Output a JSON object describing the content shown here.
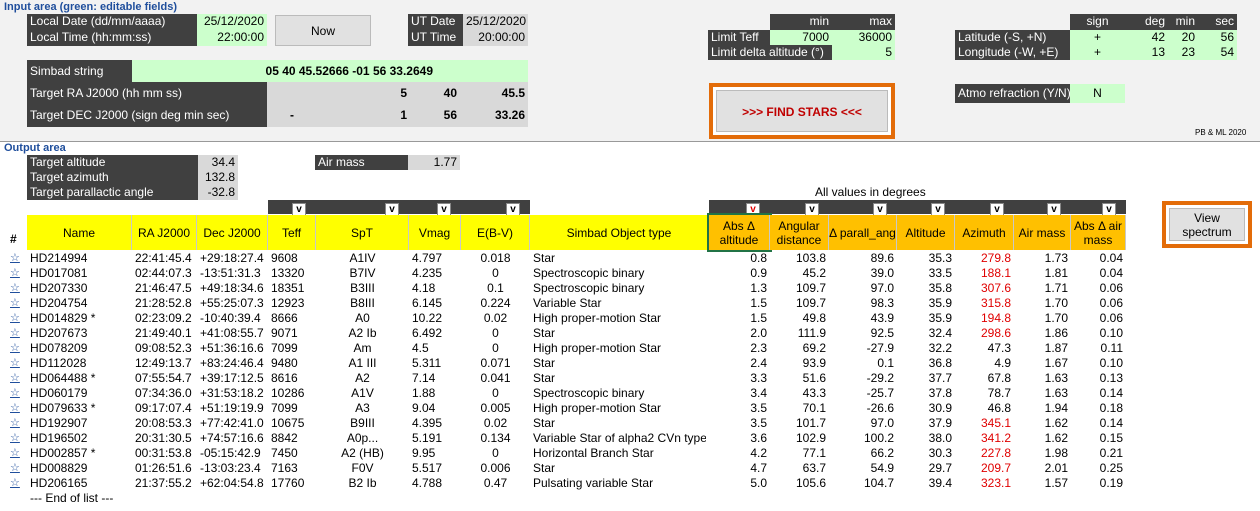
{
  "input": {
    "section_title": "Input area (green: editable fields)",
    "local_date_label": "Local Date (dd/mm/aaaa)",
    "local_date": "25/12/2020",
    "local_time_label": "Local Time (hh:mm:ss)",
    "local_time": "22:00:00",
    "now_button": "Now",
    "ut_date_label": "UT Date",
    "ut_date": "25/12/2020",
    "ut_time_label": "UT Time",
    "ut_time": "20:00:00",
    "simbad_label": "Simbad string",
    "simbad_value": "05 40 45.52666 -01 56 33.2649",
    "ra_label": "Target RA J2000 (hh mm ss)",
    "ra_sign": "",
    "ra_h": "5",
    "ra_m": "40",
    "ra_s": "45.5",
    "dec_label": "Target DEC J2000 (sign deg min sec)",
    "dec_sign": "-",
    "dec_d": "1",
    "dec_m": "56",
    "dec_s": "33.26",
    "limits_min_hdr": "min",
    "limits_max_hdr": "max",
    "teff_label": "Limit Teff",
    "teff_min": "7000",
    "teff_max": "36000",
    "dalt_label": "Limit delta altitude (°)",
    "dalt_max": "5",
    "find_button": ">>> FIND STARS <<<",
    "geo_sign_hdr": "sign",
    "geo_deg_hdr": "deg",
    "geo_min_hdr": "min",
    "geo_sec_hdr": "sec",
    "lat_label": "Latitude (-S, +N)",
    "lat_sign": "+",
    "lat_deg": "42",
    "lat_min": "20",
    "lat_sec": "56",
    "lon_label": "Longitude (-W, +E)",
    "lon_sign": "+",
    "lon_deg": "13",
    "lon_min": "23",
    "lon_sec": "54",
    "atmo_label": "Atmo refraction (Y/N)",
    "atmo_value": "N",
    "credit": "PB & ML 2020"
  },
  "output": {
    "section_title": "Output area",
    "alt_label": "Target altitude",
    "alt_value": "34.4",
    "az_label": "Target azimuth",
    "az_value": "132.8",
    "par_label": "Target parallactic angle",
    "par_value": "-32.8",
    "airmass_label": "Air mass",
    "airmass_value": "1.77",
    "all_values_note": "All values in degrees",
    "view_spectrum_button": "View spectrum",
    "filter_glyph": "v",
    "end_of_list": "--- End of list ---"
  },
  "table": {
    "hash_header": "#",
    "headers": {
      "name": "Name",
      "ra": "RA J2000",
      "dec": "Dec J2000",
      "teff": "Teff",
      "spt": "SpT",
      "vmag": "Vmag",
      "ebv": "E(B-V)",
      "otype": "Simbad Object type",
      "absalt": "Abs Δ altitude",
      "angdist": "Angular distance",
      "dpar": "Δ parall_ang",
      "alt": "Altitude",
      "az": "Azimuth",
      "airmass": "Air mass",
      "absair": "Abs Δ air mass"
    },
    "rows": [
      {
        "star": "☆",
        "name": "HD214994",
        "ra": "22:41:45.4",
        "dec": "+29:18:27.4",
        "teff": "9608",
        "spt": "A1IV",
        "vmag": "4.797",
        "ebv": "0.018",
        "otype": "Star",
        "absalt": "0.8",
        "angdist": "103.8",
        "dpar": "89.6",
        "alt": "35.3",
        "az": "279.8",
        "az_red": true,
        "airmass": "1.73",
        "absair": "0.04"
      },
      {
        "star": "☆",
        "name": "HD017081",
        "ra": "02:44:07.3",
        "dec": "-13:51:31.3",
        "teff": "13320",
        "spt": "B7IV",
        "vmag": "4.235",
        "ebv": "0",
        "otype": "Spectroscopic binary",
        "absalt": "0.9",
        "angdist": "45.2",
        "dpar": "39.0",
        "alt": "33.5",
        "az": "188.1",
        "az_red": true,
        "airmass": "1.81",
        "absair": "0.04"
      },
      {
        "star": "☆",
        "name": "HD207330",
        "ra": "21:46:47.5",
        "dec": "+49:18:34.6",
        "teff": "18351",
        "spt": "B3III",
        "vmag": "4.18",
        "ebv": "0.1",
        "otype": "Spectroscopic binary",
        "absalt": "1.3",
        "angdist": "109.7",
        "dpar": "97.0",
        "alt": "35.8",
        "az": "307.6",
        "az_red": true,
        "airmass": "1.71",
        "absair": "0.06"
      },
      {
        "star": "☆",
        "name": "HD204754",
        "ra": "21:28:52.8",
        "dec": "+55:25:07.3",
        "teff": "12923",
        "spt": "B8III",
        "vmag": "6.145",
        "ebv": "0.224",
        "otype": "Variable Star",
        "absalt": "1.5",
        "angdist": "109.7",
        "dpar": "98.3",
        "alt": "35.9",
        "az": "315.8",
        "az_red": true,
        "airmass": "1.70",
        "absair": "0.06"
      },
      {
        "star": "☆",
        "name": "HD014829 *",
        "ra": "02:23:09.2",
        "dec": "-10:40:39.4",
        "teff": "8666",
        "spt": "A0",
        "vmag": "10.22",
        "ebv": "0.02",
        "otype": "High proper-motion Star",
        "absalt": "1.5",
        "angdist": "49.8",
        "dpar": "43.9",
        "alt": "35.9",
        "az": "194.8",
        "az_red": true,
        "airmass": "1.70",
        "absair": "0.06"
      },
      {
        "star": "☆",
        "name": "HD207673",
        "ra": "21:49:40.1",
        "dec": "+41:08:55.7",
        "teff": "9071",
        "spt": "A2 Ib",
        "vmag": "6.492",
        "ebv": "0",
        "otype": "Star",
        "absalt": "2.0",
        "angdist": "111.9",
        "dpar": "92.5",
        "alt": "32.4",
        "az": "298.6",
        "az_red": true,
        "airmass": "1.86",
        "absair": "0.10"
      },
      {
        "star": "☆",
        "name": "HD078209",
        "ra": "09:08:52.3",
        "dec": "+51:36:16.6",
        "teff": "7099",
        "spt": "Am",
        "vmag": "4.5",
        "ebv": "0",
        "otype": "High proper-motion Star",
        "absalt": "2.3",
        "angdist": "69.2",
        "dpar": "-27.9",
        "alt": "32.2",
        "az": "47.3",
        "az_red": false,
        "airmass": "1.87",
        "absair": "0.11"
      },
      {
        "star": "☆",
        "name": "HD112028",
        "ra": "12:49:13.7",
        "dec": "+83:24:46.4",
        "teff": "9480",
        "spt": "A1 III",
        "vmag": "5.311",
        "ebv": "0.071",
        "otype": "Star",
        "absalt": "2.4",
        "angdist": "93.9",
        "dpar": "0.1",
        "alt": "36.8",
        "az": "4.9",
        "az_red": false,
        "airmass": "1.67",
        "absair": "0.10"
      },
      {
        "star": "☆",
        "name": "HD064488 *",
        "ra": "07:55:54.7",
        "dec": "+39:17:12.5",
        "teff": "8616",
        "spt": "A2",
        "vmag": "7.14",
        "ebv": "0.041",
        "otype": "Star",
        "absalt": "3.3",
        "angdist": "51.6",
        "dpar": "-29.2",
        "alt": "37.7",
        "az": "67.8",
        "az_red": false,
        "airmass": "1.63",
        "absair": "0.13"
      },
      {
        "star": "☆",
        "name": "HD060179",
        "ra": "07:34:36.0",
        "dec": "+31:53:18.2",
        "teff": "10286",
        "spt": "A1V",
        "vmag": "1.88",
        "ebv": "0",
        "otype": "Spectroscopic binary",
        "absalt": "3.4",
        "angdist": "43.3",
        "dpar": "-25.7",
        "alt": "37.8",
        "az": "78.7",
        "az_red": false,
        "airmass": "1.63",
        "absair": "0.14"
      },
      {
        "star": "☆",
        "name": "HD079633 *",
        "ra": "09:17:07.4",
        "dec": "+51:19:19.9",
        "teff": "7099",
        "spt": "A3",
        "vmag": "9.04",
        "ebv": "0.005",
        "otype": "High proper-motion Star",
        "absalt": "3.5",
        "angdist": "70.1",
        "dpar": "-26.6",
        "alt": "30.9",
        "az": "46.8",
        "az_red": false,
        "airmass": "1.94",
        "absair": "0.18"
      },
      {
        "star": "☆",
        "name": "HD192907",
        "ra": "20:08:53.3",
        "dec": "+77:42:41.0",
        "teff": "10675",
        "spt": "B9III",
        "vmag": "4.395",
        "ebv": "0.02",
        "otype": "Star",
        "absalt": "3.5",
        "angdist": "101.7",
        "dpar": "97.0",
        "alt": "37.9",
        "az": "345.1",
        "az_red": true,
        "airmass": "1.62",
        "absair": "0.14"
      },
      {
        "star": "☆",
        "name": "HD196502",
        "ra": "20:31:30.5",
        "dec": "+74:57:16.6",
        "teff": "8842",
        "spt": "A0p...",
        "vmag": "5.191",
        "ebv": "0.134",
        "otype": "Variable Star of alpha2 CVn type",
        "absalt": "3.6",
        "angdist": "102.9",
        "dpar": "100.2",
        "alt": "38.0",
        "az": "341.2",
        "az_red": true,
        "airmass": "1.62",
        "absair": "0.15"
      },
      {
        "star": "☆",
        "name": "HD002857 *",
        "ra": "00:31:53.8",
        "dec": "-05:15:42.9",
        "teff": "7450",
        "spt": "A2 (HB)",
        "vmag": "9.95",
        "ebv": "0",
        "otype": "Horizontal Branch Star",
        "absalt": "4.2",
        "angdist": "77.1",
        "dpar": "66.2",
        "alt": "30.3",
        "az": "227.8",
        "az_red": true,
        "airmass": "1.98",
        "absair": "0.21"
      },
      {
        "star": "☆",
        "name": "HD008829",
        "ra": "01:26:51.6",
        "dec": "-13:03:23.4",
        "teff": "7163",
        "spt": "F0V",
        "vmag": "5.517",
        "ebv": "0.006",
        "otype": "Star",
        "absalt": "4.7",
        "angdist": "63.7",
        "dpar": "54.9",
        "alt": "29.7",
        "az": "209.7",
        "az_red": true,
        "airmass": "2.01",
        "absair": "0.25"
      },
      {
        "star": "☆",
        "name": "HD206165",
        "ra": "21:37:55.2",
        "dec": "+62:04:54.8",
        "teff": "17760",
        "spt": "B2 Ib",
        "vmag": "4.788",
        "ebv": "0.47",
        "otype": "Pulsating variable Star",
        "absalt": "5.0",
        "angdist": "105.6",
        "dpar": "104.7",
        "alt": "39.4",
        "az": "323.1",
        "az_red": true,
        "airmass": "1.57",
        "absair": "0.19"
      }
    ]
  },
  "colors": {
    "editable_green": "#ccffcc",
    "dark_label": "#404040",
    "header_yellow": "#ffff00",
    "header_orange": "#ffc000",
    "button_border_orange": "#e36c09",
    "azimuth_red": "#e00000",
    "section_blue": "#1f4e9c"
  }
}
